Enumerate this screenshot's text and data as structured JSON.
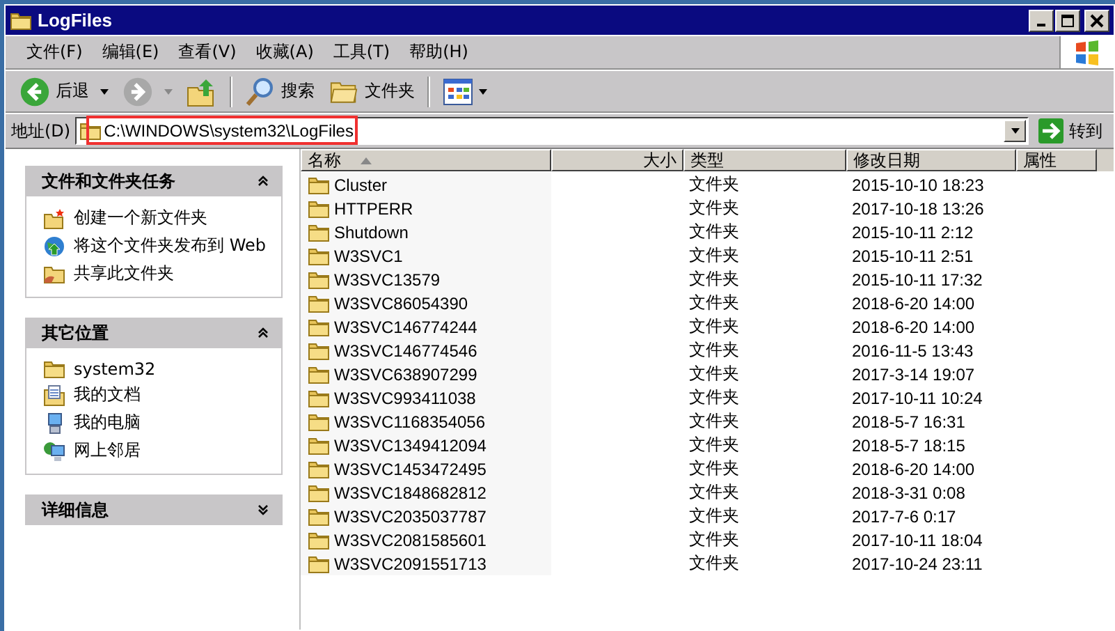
{
  "window": {
    "title": "LogFiles"
  },
  "menu": [
    "文件(F)",
    "编辑(E)",
    "查看(V)",
    "收藏(A)",
    "工具(T)",
    "帮助(H)"
  ],
  "toolbar": {
    "back": "后退",
    "search": "搜索",
    "folders": "文件夹"
  },
  "address": {
    "label": "地址(D)",
    "value": "C:\\WINDOWS\\system32\\LogFiles",
    "highlighted": true,
    "go": "转到"
  },
  "panels": [
    {
      "title": "文件和文件夹任务",
      "expanded": true,
      "items": [
        {
          "kind": "newfolder",
          "label": "创建一个新文件夹"
        },
        {
          "kind": "publish",
          "label": "将这个文件夹发布到 Web"
        },
        {
          "kind": "share",
          "label": "共享此文件夹"
        }
      ]
    },
    {
      "title": "其它位置",
      "expanded": true,
      "items": [
        {
          "kind": "folder",
          "label": "system32"
        },
        {
          "kind": "docs",
          "label": "我的文档"
        },
        {
          "kind": "computer",
          "label": "我的电脑"
        },
        {
          "kind": "network",
          "label": "网上邻居"
        }
      ]
    },
    {
      "title": "详细信息",
      "expanded": false
    }
  ],
  "table": {
    "columns": [
      {
        "label": "名称",
        "sorted": true
      },
      {
        "label": "大小",
        "sorted": false
      },
      {
        "label": "类型",
        "sorted": false
      },
      {
        "label": "修改日期",
        "sorted": false
      },
      {
        "label": "属性",
        "sorted": false
      }
    ],
    "rows": [
      [
        "Cluster",
        "",
        "文件夹",
        "2015-10-10 18:23"
      ],
      [
        "HTTPERR",
        "",
        "文件夹",
        "2017-10-18 13:26"
      ],
      [
        "Shutdown",
        "",
        "文件夹",
        "2015-10-11 2:12"
      ],
      [
        "W3SVC1",
        "",
        "文件夹",
        "2015-10-11 2:51"
      ],
      [
        "W3SVC13579",
        "",
        "文件夹",
        "2015-10-11 17:32"
      ],
      [
        "W3SVC86054390",
        "",
        "文件夹",
        "2018-6-20 14:00"
      ],
      [
        "W3SVC146774244",
        "",
        "文件夹",
        "2018-6-20 14:00"
      ],
      [
        "W3SVC146774546",
        "",
        "文件夹",
        "2016-11-5 13:43"
      ],
      [
        "W3SVC638907299",
        "",
        "文件夹",
        "2017-3-14 19:07"
      ],
      [
        "W3SVC993411038",
        "",
        "文件夹",
        "2017-10-11 10:24"
      ],
      [
        "W3SVC1168354056",
        "",
        "文件夹",
        "2018-5-7 16:31"
      ],
      [
        "W3SVC1349412094",
        "",
        "文件夹",
        "2018-5-7 18:15"
      ],
      [
        "W3SVC1453472495",
        "",
        "文件夹",
        "2018-6-20 14:00"
      ],
      [
        "W3SVC1848682812",
        "",
        "文件夹",
        "2018-3-31 0:08"
      ],
      [
        "W3SVC2035037787",
        "",
        "文件夹",
        "2017-7-6 0:17"
      ],
      [
        "W3SVC2081585601",
        "",
        "文件夹",
        "2017-10-11 18:04"
      ],
      [
        "W3SVC2091551713",
        "",
        "文件夹",
        "2017-10-24 23:11"
      ]
    ]
  }
}
